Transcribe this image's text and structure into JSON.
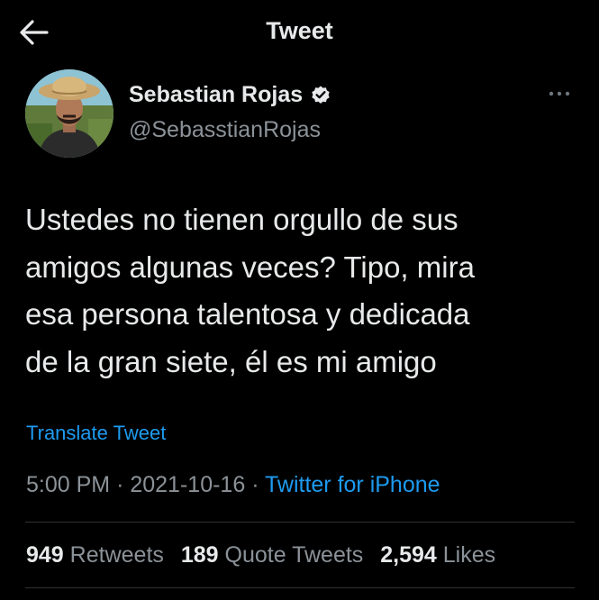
{
  "header": {
    "title": "Tweet",
    "back_icon": "arrow-left-icon"
  },
  "author": {
    "name": "Sebastian Rojas",
    "handle": "@SebasstianRojas",
    "verified_icon": "verified-badge-icon",
    "avatar_icon": "profile-photo"
  },
  "more_icon": "more-horizontal-icon",
  "tweet": {
    "lines": [
      "Ustedes no tienen orgullo de sus",
      "amigos algunas veces? Tipo, mira",
      "esa persona talentosa y dedicada",
      "de la gran siete, él es mi amigo"
    ],
    "translate_label": "Translate Tweet"
  },
  "meta": {
    "time": "5:00 PM",
    "separator": "·",
    "date": "2021-10-16",
    "source": "Twitter for iPhone"
  },
  "stats": [
    {
      "count": "949",
      "label": "Retweets"
    },
    {
      "count": "189",
      "label": "Quote Tweets"
    },
    {
      "count": "2,594",
      "label": "Likes"
    }
  ],
  "colors": {
    "background": "#000000",
    "text": "#e7e9ea",
    "secondary": "#8b9298",
    "accent": "#1d9bf0",
    "divider": "#2f3336"
  }
}
